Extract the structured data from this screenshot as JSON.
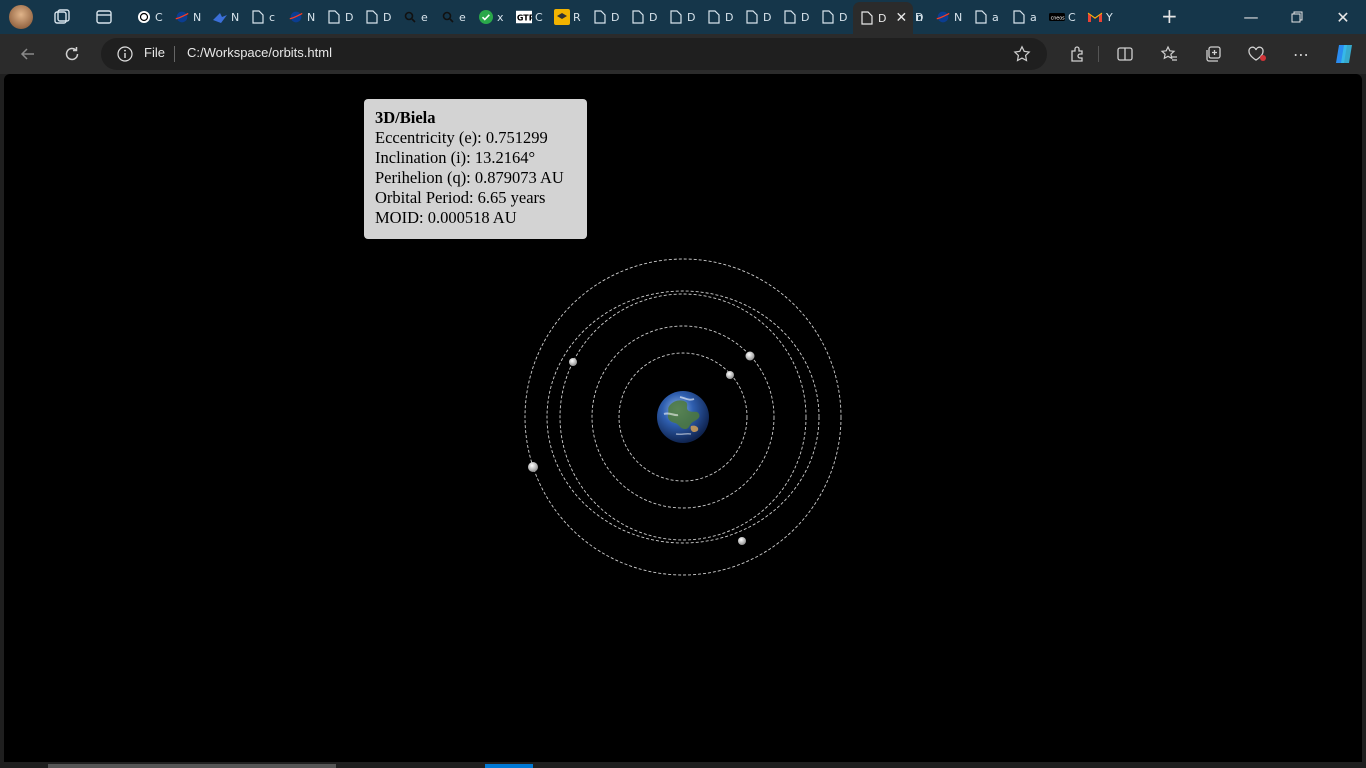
{
  "browser": {
    "address": {
      "scheme_label": "File",
      "url": "C:/Workspace/orbits.html"
    },
    "tabs": [
      {
        "letter": "C",
        "icon": "openai-icon"
      },
      {
        "letter": "N",
        "icon": "nasa-icon"
      },
      {
        "letter": "N",
        "icon": "bird-icon"
      },
      {
        "letter": "c",
        "icon": "page-icon"
      },
      {
        "letter": "N",
        "icon": "nasa-icon"
      },
      {
        "letter": "D",
        "icon": "page-icon"
      },
      {
        "letter": "D",
        "icon": "page-icon"
      },
      {
        "letter": "e",
        "icon": "search-icon"
      },
      {
        "letter": "e",
        "icon": "search-icon"
      },
      {
        "letter": "x",
        "icon": "check-icon"
      },
      {
        "letter": "C",
        "icon": "gtr-icon"
      },
      {
        "letter": "R",
        "icon": "cap-icon"
      },
      {
        "letter": "D",
        "icon": "page-icon"
      },
      {
        "letter": "D",
        "icon": "page-icon"
      },
      {
        "letter": "D",
        "icon": "page-icon"
      },
      {
        "letter": "D",
        "icon": "page-icon"
      },
      {
        "letter": "D",
        "icon": "page-icon"
      },
      {
        "letter": "D",
        "icon": "page-icon"
      },
      {
        "letter": "D",
        "icon": "page-icon"
      },
      {
        "letter": "D",
        "icon": "page-icon"
      },
      {
        "letter": "D",
        "icon": "page-icon"
      },
      {
        "letter": "n",
        "icon": "search-icon"
      },
      {
        "letter": "N",
        "icon": "nasa-icon"
      },
      {
        "letter": "a",
        "icon": "page-icon"
      },
      {
        "letter": "a",
        "icon": "page-icon"
      },
      {
        "letter": "C",
        "icon": "cneos-icon"
      },
      {
        "letter": "Y",
        "icon": "gmail-icon"
      }
    ],
    "active_tab": {
      "letter": "D",
      "icon": "page-icon"
    }
  },
  "tooltip": {
    "name": "3D/Biela",
    "eccentricity": "Eccentricity (e): 0.751299",
    "inclination": "Inclination (i): 13.2164°",
    "perihelion": "Perihelion (q): 0.879073 AU",
    "period": "Orbital Period: 6.65 years",
    "moid": "MOID: 0.000518 AU"
  },
  "colors": {
    "tabbar": "#15364a",
    "toolbar": "#2b2b2b",
    "canvas": "#000000",
    "tooltip_bg": "#d3d3d3",
    "orbit_stroke": "#cfcfcf"
  }
}
